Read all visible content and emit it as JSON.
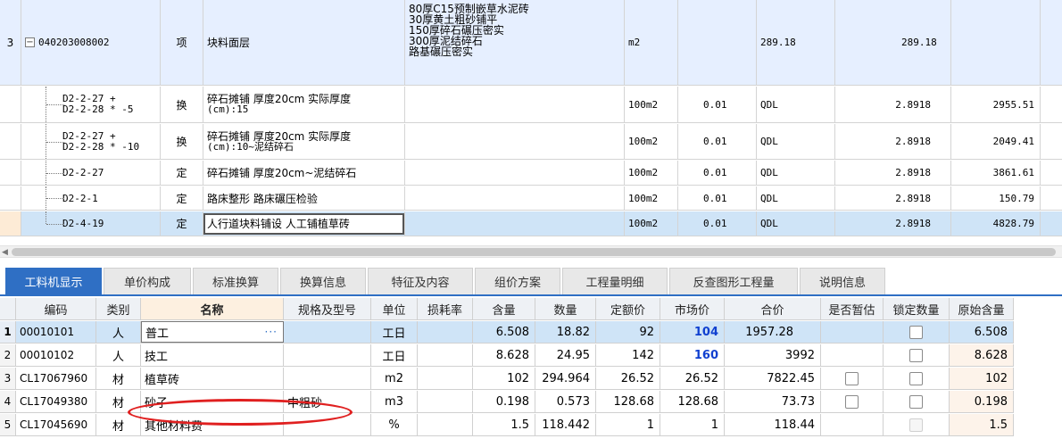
{
  "upper_rows": [
    {
      "num": "3",
      "code": "040203008002",
      "type": "项",
      "name": "块料面层",
      "features": [
        "80厚C15预制嵌草水泥砖",
        "30厚黄土粗砂铺平",
        "150厚碎石碾压密实",
        "300厚泥结碎石",
        "路基碾压密实"
      ],
      "unit": "m2",
      "coef": "",
      "qty_expr": "289.18",
      "qty": "289.18",
      "price": ""
    },
    {
      "num": "",
      "code": [
        "D2-2-27 +",
        "D2-2-28 * -5"
      ],
      "type": "换",
      "name": [
        "碎石摊铺 厚度20cm  实际厚度",
        "(cm):15"
      ],
      "features": [],
      "unit": "100m2",
      "coef": "0.01",
      "qty_expr": "QDL",
      "qty": "2.8918",
      "price": "2955.51"
    },
    {
      "num": "",
      "code": [
        "D2-2-27 +",
        "D2-2-28 * -10"
      ],
      "type": "换",
      "name": [
        "碎石摊铺 厚度20cm  实际厚度",
        "(cm):10~泥结碎石"
      ],
      "features": [],
      "unit": "100m2",
      "coef": "0.01",
      "qty_expr": "QDL",
      "qty": "2.8918",
      "price": "2049.41"
    },
    {
      "num": "",
      "code": [
        "D2-2-27"
      ],
      "type": "定",
      "name": [
        "碎石摊铺 厚度20cm~泥结碎石"
      ],
      "features": [],
      "unit": "100m2",
      "coef": "0.01",
      "qty_expr": "QDL",
      "qty": "2.8918",
      "price": "3861.61"
    },
    {
      "num": "",
      "code": [
        "D2-2-1"
      ],
      "type": "定",
      "name": [
        "路床整形 路床碾压检验"
      ],
      "features": [],
      "unit": "100m2",
      "coef": "0.01",
      "qty_expr": "QDL",
      "qty": "2.8918",
      "price": "150.79"
    },
    {
      "num": "",
      "code": [
        "D2-4-19"
      ],
      "type": "定",
      "name": [
        "人行道块料铺设 人工铺植草砖"
      ],
      "features": [],
      "unit": "100m2",
      "coef": "0.01",
      "qty_expr": "QDL",
      "qty": "2.8918",
      "price": "4828.79"
    }
  ],
  "tabs": [
    "工料机显示",
    "单价构成",
    "标准换算",
    "换算信息",
    "特征及内容",
    "组价方案",
    "工程量明细",
    "反查图形工程量",
    "说明信息"
  ],
  "lower_headers": [
    "编码",
    "类别",
    "名称",
    "规格及型号",
    "单位",
    "损耗率",
    "含量",
    "数量",
    "定额价",
    "市场价",
    "合价",
    "是否暂估",
    "锁定数量",
    "原始含量"
  ],
  "lower_rows": [
    {
      "num": "1",
      "code": "00010101",
      "cat": "人",
      "name": "普工",
      "spec": "",
      "unit": "工日",
      "loss": "",
      "content": "6.508",
      "qty": "18.82",
      "base_price": "92",
      "market_price": "104",
      "total": "1957.28",
      "estimate": false,
      "lock": true,
      "orig": "6.508"
    },
    {
      "num": "2",
      "code": "00010102",
      "cat": "人",
      "name": "技工",
      "spec": "",
      "unit": "工日",
      "loss": "",
      "content": "8.628",
      "qty": "24.95",
      "base_price": "142",
      "market_price": "160",
      "total": "3992",
      "estimate": false,
      "lock": true,
      "orig": "8.628"
    },
    {
      "num": "3",
      "code": "CL17067960",
      "cat": "材",
      "name": "植草砖",
      "spec": "",
      "unit": "m2",
      "loss": "",
      "content": "102",
      "qty": "294.964",
      "base_price": "26.52",
      "market_price": "26.52",
      "total": "7822.45",
      "estimate": true,
      "lock": true,
      "orig": "102"
    },
    {
      "num": "4",
      "code": "CL17049380",
      "cat": "材",
      "name": "砂子",
      "spec": "中粗砂",
      "unit": "m3",
      "loss": "",
      "content": "0.198",
      "qty": "0.573",
      "base_price": "128.68",
      "market_price": "128.68",
      "total": "73.73",
      "estimate": true,
      "lock": true,
      "orig": "0.198"
    },
    {
      "num": "5",
      "code": "CL17045690",
      "cat": "材",
      "name": "其他材料费",
      "spec": "",
      "unit": "%",
      "loss": "",
      "content": "1.5",
      "qty": "118.442",
      "base_price": "1",
      "market_price": "1",
      "total": "118.44",
      "estimate": false,
      "lock": true,
      "orig": "1.5"
    }
  ],
  "colors": {
    "accent": "#2f6fc4",
    "selected_row": "#cfe4f7",
    "annotation": "#e02020",
    "market_price": "#1040d0"
  }
}
